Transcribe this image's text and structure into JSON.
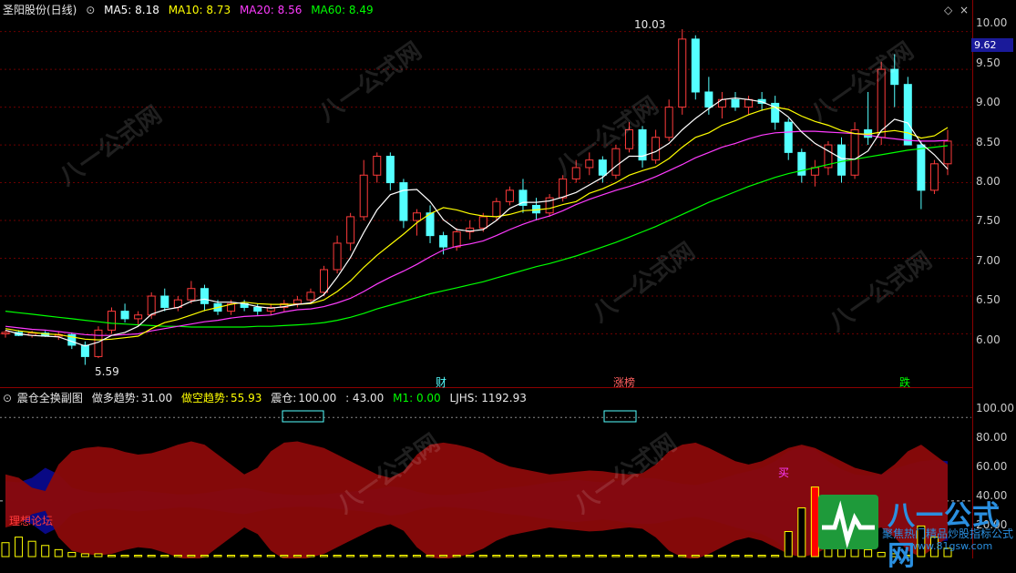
{
  "main_header": {
    "stock_name": "圣阳股份(日线)",
    "ma5": "MA5: 8.18",
    "ma10": "MA10: 8.73",
    "ma20": "MA20: 8.56",
    "ma60": "MA60: 8.49"
  },
  "sub_header": {
    "indicator_name": "震仓全换副图",
    "long_trend_label": "做多趋势:",
    "long_trend_value": "31.00",
    "short_trend_label": "做空趋势:",
    "short_trend_value": "55.93",
    "shake_label": "震仓:",
    "shake_value": "100.00",
    "extra_value": ": 43.00",
    "m1": "M1: 0.00",
    "ljhs": "LJHS: 1192.93"
  },
  "price_axis": {
    "ticks": [
      "10.00",
      "9.50",
      "9.00",
      "8.50",
      "8.00",
      "7.50",
      "7.00",
      "6.50",
      "6.00"
    ],
    "current_price": "9.62"
  },
  "sub_axis": {
    "ticks": [
      "100.00",
      "80.00",
      "60.00",
      "40.00",
      "20.00"
    ]
  },
  "annotations": {
    "high": "10.03",
    "low": "5.59",
    "event_finance": "财",
    "event_rank": "涨榜",
    "event_fall": "跌",
    "buy_signal": "买",
    "forum": "理想论坛"
  },
  "watermark": {
    "text": "八一公式网"
  },
  "logo": {
    "title": "八一公式网",
    "subtitle": "聚焦热门精品炒股指标公式",
    "url": "www.81gsw.com"
  },
  "colors": {
    "up": "#ff3b3b",
    "down": "#54ffff",
    "ma5": "#ffffff",
    "ma10": "#ffff00",
    "ma20": "#ff3bff",
    "ma60": "#00ff00",
    "long_area": "#8b0a0a",
    "short_area": "#0a0a8b"
  },
  "chart_data": {
    "type": "candlestick",
    "price_ylim": [
      5.5,
      10.2
    ],
    "candles": [
      [
        6.0,
        6.05,
        5.95,
        6.02
      ],
      [
        6.02,
        6.05,
        5.97,
        5.98
      ],
      [
        5.98,
        6.04,
        5.95,
        6.01
      ],
      [
        6.01,
        6.04,
        5.96,
        5.97
      ],
      [
        5.97,
        6.03,
        5.92,
        5.99
      ],
      [
        5.99,
        6.02,
        5.8,
        5.85
      ],
      [
        5.85,
        5.9,
        5.59,
        5.7
      ],
      [
        5.7,
        6.1,
        5.68,
        6.05
      ],
      [
        6.05,
        6.35,
        6.0,
        6.3
      ],
      [
        6.3,
        6.4,
        6.15,
        6.2
      ],
      [
        6.2,
        6.3,
        6.1,
        6.25
      ],
      [
        6.25,
        6.55,
        6.2,
        6.5
      ],
      [
        6.5,
        6.6,
        6.3,
        6.35
      ],
      [
        6.35,
        6.5,
        6.3,
        6.45
      ],
      [
        6.45,
        6.7,
        6.4,
        6.6
      ],
      [
        6.6,
        6.65,
        6.3,
        6.4
      ],
      [
        6.4,
        6.45,
        6.25,
        6.3
      ],
      [
        6.3,
        6.45,
        6.25,
        6.4
      ],
      [
        6.4,
        6.45,
        6.3,
        6.35
      ],
      [
        6.35,
        6.4,
        6.25,
        6.3
      ],
      [
        6.3,
        6.4,
        6.25,
        6.35
      ],
      [
        6.35,
        6.45,
        6.3,
        6.4
      ],
      [
        6.4,
        6.5,
        6.35,
        6.45
      ],
      [
        6.45,
        6.6,
        6.4,
        6.55
      ],
      [
        6.55,
        6.9,
        6.5,
        6.85
      ],
      [
        6.85,
        7.3,
        6.8,
        7.2
      ],
      [
        7.2,
        7.6,
        7.1,
        7.55
      ],
      [
        7.55,
        8.3,
        7.5,
        8.1
      ],
      [
        8.1,
        8.4,
        8.0,
        8.35
      ],
      [
        8.35,
        8.4,
        7.9,
        8.0
      ],
      [
        8.0,
        8.05,
        7.4,
        7.5
      ],
      [
        7.5,
        7.65,
        7.3,
        7.6
      ],
      [
        7.6,
        7.7,
        7.2,
        7.3
      ],
      [
        7.3,
        7.35,
        7.05,
        7.15
      ],
      [
        7.15,
        7.4,
        7.1,
        7.35
      ],
      [
        7.35,
        7.5,
        7.25,
        7.4
      ],
      [
        7.4,
        7.6,
        7.35,
        7.55
      ],
      [
        7.55,
        7.8,
        7.5,
        7.75
      ],
      [
        7.75,
        7.95,
        7.7,
        7.9
      ],
      [
        7.9,
        8.05,
        7.6,
        7.7
      ],
      [
        7.7,
        7.8,
        7.5,
        7.6
      ],
      [
        7.6,
        7.85,
        7.55,
        7.8
      ],
      [
        7.8,
        8.1,
        7.75,
        8.05
      ],
      [
        8.05,
        8.3,
        8.0,
        8.2
      ],
      [
        8.2,
        8.4,
        8.1,
        8.3
      ],
      [
        8.3,
        8.35,
        8.0,
        8.1
      ],
      [
        8.1,
        8.5,
        8.05,
        8.45
      ],
      [
        8.45,
        8.8,
        8.4,
        8.7
      ],
      [
        8.7,
        8.75,
        8.2,
        8.3
      ],
      [
        8.3,
        8.7,
        8.25,
        8.6
      ],
      [
        8.6,
        9.1,
        8.55,
        9.0
      ],
      [
        9.0,
        10.03,
        8.9,
        9.9
      ],
      [
        9.9,
        9.95,
        9.1,
        9.2
      ],
      [
        9.2,
        9.4,
        8.9,
        9.0
      ],
      [
        9.0,
        9.2,
        8.85,
        9.1
      ],
      [
        9.1,
        9.2,
        8.95,
        9.0
      ],
      [
        9.0,
        9.15,
        8.9,
        9.1
      ],
      [
        9.1,
        9.2,
        8.95,
        9.05
      ],
      [
        9.05,
        9.15,
        8.7,
        8.8
      ],
      [
        8.8,
        8.85,
        8.3,
        8.4
      ],
      [
        8.4,
        8.45,
        8.0,
        8.1
      ],
      [
        8.1,
        8.3,
        7.95,
        8.2
      ],
      [
        8.2,
        8.55,
        8.1,
        8.5
      ],
      [
        8.5,
        8.6,
        8.0,
        8.1
      ],
      [
        8.1,
        8.8,
        8.05,
        8.7
      ],
      [
        8.7,
        9.2,
        8.5,
        8.6
      ],
      [
        8.6,
        9.6,
        8.5,
        9.5
      ],
      [
        9.5,
        9.7,
        9.0,
        9.3
      ],
      [
        9.3,
        9.4,
        8.6,
        8.5
      ],
      [
        8.5,
        8.55,
        7.65,
        7.9
      ],
      [
        7.9,
        8.3,
        7.85,
        8.25
      ],
      [
        8.25,
        8.7,
        8.1,
        8.55
      ]
    ],
    "ma5": [
      6.05,
      6.0,
      5.98,
      5.97,
      5.96,
      5.9,
      5.84,
      5.89,
      5.98,
      6.02,
      6.1,
      6.26,
      6.32,
      6.35,
      6.43,
      6.46,
      6.42,
      6.42,
      6.4,
      6.36,
      6.34,
      6.36,
      6.39,
      6.41,
      6.52,
      6.75,
      7.01,
      7.34,
      7.64,
      7.84,
      7.9,
      7.91,
      7.75,
      7.51,
      7.38,
      7.36,
      7.38,
      7.5,
      7.66,
      7.74,
      7.74,
      7.76,
      7.81,
      7.87,
      7.97,
      8.07,
      8.22,
      8.35,
      8.35,
      8.41,
      8.52,
      8.7,
      8.85,
      8.98,
      9.1,
      9.12,
      9.1,
      9.07,
      9.0,
      8.87,
      8.67,
      8.52,
      8.42,
      8.32,
      8.31,
      8.42,
      8.69,
      8.84,
      8.79,
      8.52,
      8.37,
      8.18
    ],
    "ma10": [
      6.07,
      6.04,
      6.02,
      6.0,
      5.99,
      5.96,
      5.93,
      5.92,
      5.93,
      5.95,
      5.97,
      6.07,
      6.15,
      6.19,
      6.25,
      6.31,
      6.35,
      6.39,
      6.42,
      6.4,
      6.39,
      6.39,
      6.39,
      6.4,
      6.45,
      6.56,
      6.7,
      6.88,
      7.04,
      7.18,
      7.32,
      7.47,
      7.59,
      7.67,
      7.64,
      7.59,
      7.56,
      7.55,
      7.58,
      7.63,
      7.64,
      7.66,
      7.71,
      7.75,
      7.86,
      7.92,
      8.0,
      8.1,
      8.16,
      8.21,
      8.32,
      8.47,
      8.6,
      8.66,
      8.76,
      8.82,
      8.9,
      8.96,
      9.0,
      8.97,
      8.88,
      8.81,
      8.76,
      8.69,
      8.65,
      8.64,
      8.67,
      8.69,
      8.66,
      8.59,
      8.62,
      8.73
    ],
    "ma20": [
      6.1,
      6.08,
      6.06,
      6.05,
      6.03,
      6.01,
      5.99,
      5.98,
      5.98,
      5.99,
      6.0,
      6.04,
      6.07,
      6.1,
      6.13,
      6.16,
      6.18,
      6.21,
      6.23,
      6.24,
      6.25,
      6.29,
      6.32,
      6.33,
      6.36,
      6.41,
      6.47,
      6.56,
      6.66,
      6.75,
      6.83,
      6.92,
      7.02,
      7.11,
      7.16,
      7.19,
      7.23,
      7.3,
      7.38,
      7.45,
      7.51,
      7.56,
      7.63,
      7.71,
      7.78,
      7.84,
      7.9,
      7.95,
      8.01,
      8.08,
      8.16,
      8.24,
      8.33,
      8.4,
      8.47,
      8.52,
      8.58,
      8.63,
      8.66,
      8.67,
      8.68,
      8.68,
      8.67,
      8.66,
      8.65,
      8.63,
      8.6,
      8.58,
      8.56,
      8.55,
      8.55,
      8.56
    ],
    "ma60": [
      6.3,
      6.28,
      6.26,
      6.24,
      6.22,
      6.2,
      6.18,
      6.16,
      6.14,
      6.13,
      6.12,
      6.11,
      6.1,
      6.1,
      6.09,
      6.09,
      6.09,
      6.09,
      6.09,
      6.1,
      6.1,
      6.11,
      6.12,
      6.13,
      6.15,
      6.18,
      6.22,
      6.27,
      6.33,
      6.38,
      6.43,
      6.48,
      6.53,
      6.57,
      6.61,
      6.65,
      6.69,
      6.74,
      6.79,
      6.84,
      6.89,
      6.93,
      6.98,
      7.03,
      7.09,
      7.15,
      7.21,
      7.28,
      7.35,
      7.42,
      7.5,
      7.58,
      7.66,
      7.74,
      7.81,
      7.88,
      7.95,
      8.01,
      8.07,
      8.12,
      8.16,
      8.2,
      8.24,
      8.28,
      8.31,
      8.34,
      8.37,
      8.4,
      8.43,
      8.45,
      8.47,
      8.49
    ],
    "sub_ylim": [
      0,
      110
    ],
    "long_trend": [
      40,
      35,
      20,
      15,
      55,
      75,
      80,
      82,
      80,
      74,
      70,
      72,
      78,
      85,
      90,
      85,
      70,
      55,
      40,
      50,
      75,
      88,
      90,
      85,
      80,
      70,
      60,
      50,
      40,
      35,
      45,
      70,
      85,
      88,
      85,
      80,
      72,
      60,
      52,
      48,
      44,
      40,
      42,
      44,
      46,
      45,
      42,
      40,
      42,
      55,
      75,
      85,
      88,
      80,
      70,
      60,
      55,
      60,
      70,
      80,
      85,
      80,
      70,
      60,
      50,
      45,
      40,
      55,
      75,
      85,
      70,
      55
    ],
    "short_trend": [
      30,
      28,
      35,
      50,
      40,
      20,
      15,
      12,
      12,
      14,
      16,
      14,
      12,
      10,
      10,
      12,
      15,
      18,
      20,
      16,
      12,
      10,
      9,
      9,
      10,
      12,
      14,
      16,
      18,
      22,
      20,
      14,
      10,
      9,
      10,
      12,
      14,
      18,
      20,
      22,
      25,
      28,
      30,
      32,
      30,
      28,
      30,
      34,
      35,
      34,
      30,
      26,
      24,
      28,
      34,
      40,
      45,
      50,
      60,
      75,
      82,
      78,
      60,
      48,
      40,
      38,
      40,
      48,
      55,
      60,
      62,
      60
    ],
    "volume_bars": [
      10,
      14,
      11,
      8,
      5,
      3,
      2,
      2,
      1,
      1,
      1,
      1,
      1,
      1,
      1,
      1,
      1,
      1,
      1,
      1,
      1,
      1,
      1,
      1,
      1,
      1,
      1,
      1,
      1,
      1,
      1,
      1,
      1,
      1,
      1,
      1,
      1,
      1,
      1,
      1,
      1,
      1,
      1,
      1,
      1,
      1,
      1,
      1,
      1,
      1,
      1,
      1,
      1,
      1,
      1,
      1,
      1,
      1,
      1,
      18,
      35,
      50,
      30,
      12,
      8,
      5,
      3,
      2,
      1,
      22,
      14,
      6
    ]
  }
}
